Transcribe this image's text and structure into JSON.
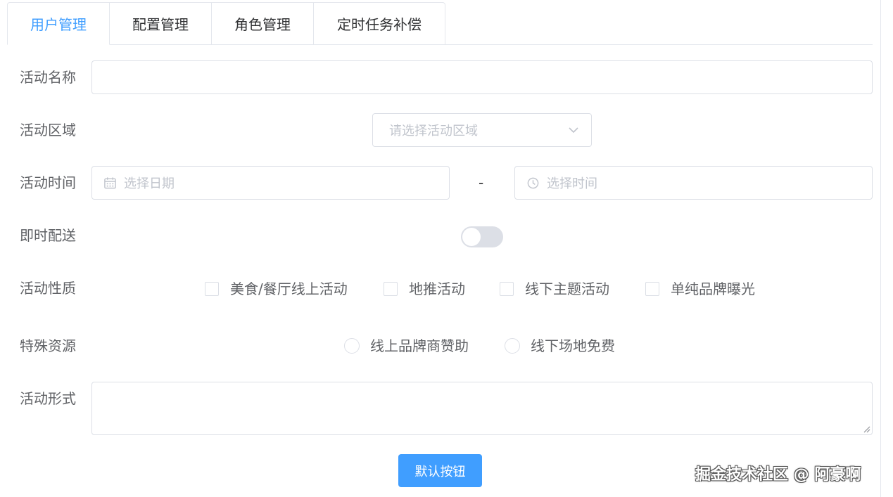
{
  "tabs": [
    {
      "label": "用户管理",
      "active": true
    },
    {
      "label": "配置管理",
      "active": false
    },
    {
      "label": "角色管理",
      "active": false
    },
    {
      "label": "定时任务补偿",
      "active": false
    }
  ],
  "form": {
    "name": {
      "label": "活动名称",
      "value": ""
    },
    "region": {
      "label": "活动区域",
      "placeholder": "请选择活动区域",
      "icon": "chevron-down-icon"
    },
    "time": {
      "label": "活动时间",
      "date_placeholder": "选择日期",
      "time_placeholder": "选择时间",
      "separator": "-",
      "date_icon": "calendar-icon",
      "time_icon": "clock-icon"
    },
    "delivery": {
      "label": "即时配送",
      "on": false
    },
    "type": {
      "label": "活动性质",
      "options": [
        "美食/餐厅线上活动",
        "地推活动",
        "线下主题活动",
        "单纯品牌曝光"
      ]
    },
    "resource": {
      "label": "特殊资源",
      "options": [
        "线上品牌商赞助",
        "线下场地免费"
      ]
    },
    "desc": {
      "label": "活动形式",
      "value": ""
    }
  },
  "button": {
    "label": "默认按钮"
  },
  "watermark": "掘金技术社区 @ 阿豪啊",
  "colors": {
    "accent": "#409eff",
    "border": "#dcdfe6",
    "placeholder": "#c0c4cc",
    "text": "#606266"
  }
}
